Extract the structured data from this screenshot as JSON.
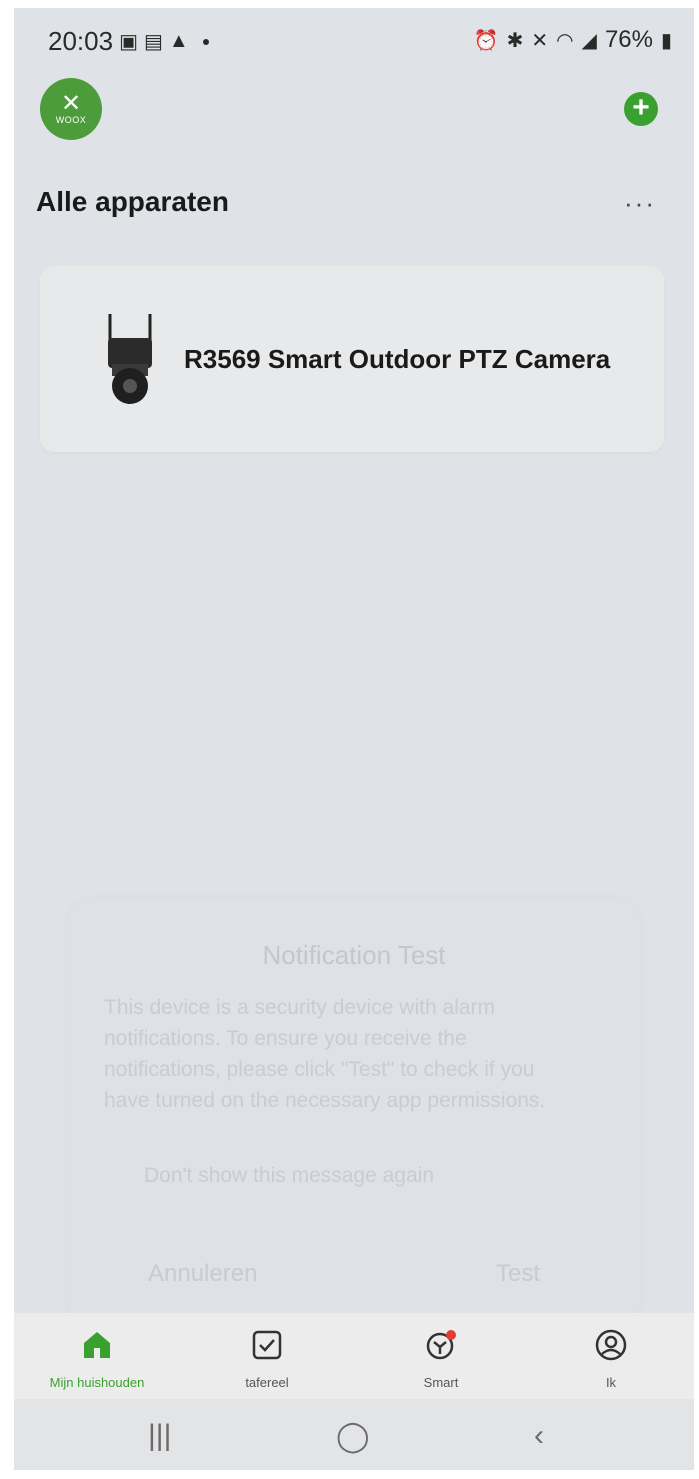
{
  "status_bar": {
    "time": "20:03",
    "battery": "76%",
    "left_icons": [
      "gallery-icon",
      "linkedin-icon",
      "warning-icon"
    ],
    "right_icons": [
      "alarm-icon",
      "bluetooth-icon",
      "mute-icon",
      "wifi-icon",
      "signal-icon",
      "battery-icon"
    ]
  },
  "header": {
    "logo_text": "WOOX",
    "title": "Alle apparaten",
    "more_label": "···"
  },
  "devices": [
    {
      "name": "R3569 Smart Outdoor PTZ Camera"
    }
  ],
  "dialog": {
    "title": "Notification Test",
    "body": "This device is a security device with alarm notifications. To ensure you receive the notifications, please click \"Test\" to check if you have turned on the necessary app permissions.",
    "checkbox_label": "Don't show this message again",
    "cancel_label": "Annuleren",
    "test_label": "Test"
  },
  "tabs": [
    {
      "label": "Mijn huishouden",
      "icon": "home-icon",
      "active": true
    },
    {
      "label": "tafereel",
      "icon": "checkbox-icon",
      "active": false
    },
    {
      "label": "Smart",
      "icon": "smart-icon",
      "active": false
    },
    {
      "label": "Ik",
      "icon": "profile-icon",
      "active": false
    }
  ],
  "colors": {
    "accent": "#3aa131",
    "background": "#dfe2e6",
    "card": "#e8e9eb",
    "badge": "#e53935"
  }
}
